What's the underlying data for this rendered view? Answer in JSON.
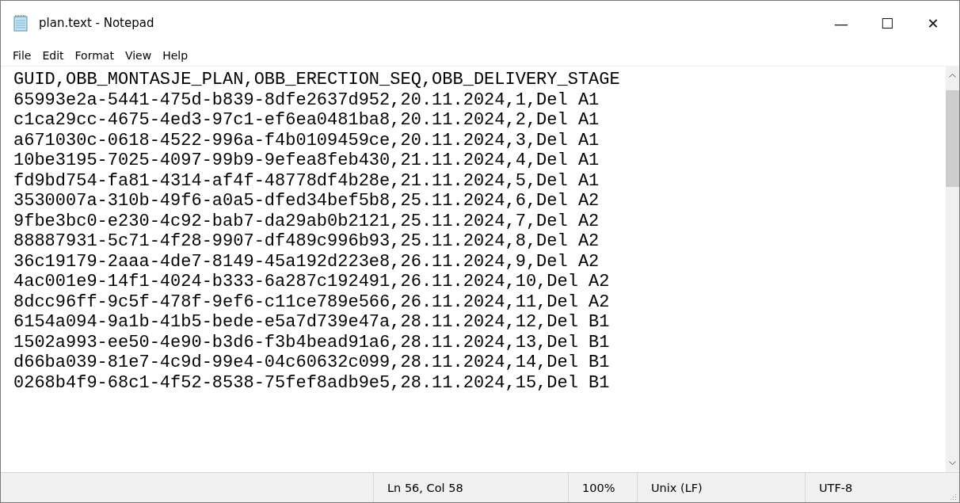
{
  "window": {
    "title": "plan.text - Notepad",
    "controls": [
      "—",
      "☐",
      "✕"
    ]
  },
  "menu": [
    "File",
    "Edit",
    "Format",
    "View",
    "Help"
  ],
  "lines": [
    "GUID,OBB_MONTASJE_PLAN,OBB_ERECTION_SEQ,OBB_DELIVERY_STAGE",
    "65993e2a-5441-475d-b839-8dfe2637d952,20.11.2024,1,Del A1",
    "c1ca29cc-4675-4ed3-97c1-ef6ea0481ba8,20.11.2024,2,Del A1",
    "a671030c-0618-4522-996a-f4b0109459ce,20.11.2024,3,Del A1",
    "10be3195-7025-4097-99b9-9efea8feb430,21.11.2024,4,Del A1",
    "fd9bd754-fa81-4314-af4f-48778df4b28e,21.11.2024,5,Del A1",
    "3530007a-310b-49f6-a0a5-dfed34bef5b8,25.11.2024,6,Del A2",
    "9fbe3bc0-e230-4c92-bab7-da29ab0b2121,25.11.2024,7,Del A2",
    "88887931-5c71-4f28-9907-df489c996b93,25.11.2024,8,Del A2",
    "36c19179-2aaa-4de7-8149-45a192d223e8,26.11.2024,9,Del A2",
    "4ac001e9-14f1-4024-b333-6a287c192491,26.11.2024,10,Del A2",
    "8dcc96ff-9c5f-478f-9ef6-c11ce789e566,26.11.2024,11,Del A2",
    "6154a094-9a1b-41b5-bede-e5a7d739e47a,28.11.2024,12,Del B1",
    "1502a993-ee50-4e90-b3d6-f3b4bead91a6,28.11.2024,13,Del B1",
    "d66ba039-81e7-4c9d-99e4-04c60632c099,28.11.2024,14,Del B1",
    "0268b4f9-68c1-4f52-8538-75fef8adb9e5,28.11.2024,15,Del B1"
  ],
  "status_bar": {
    "position": "Ln 56, Col 58",
    "zoom": "100%",
    "line_endings": "Unix (LF)",
    "encoding": "UTF-8"
  }
}
